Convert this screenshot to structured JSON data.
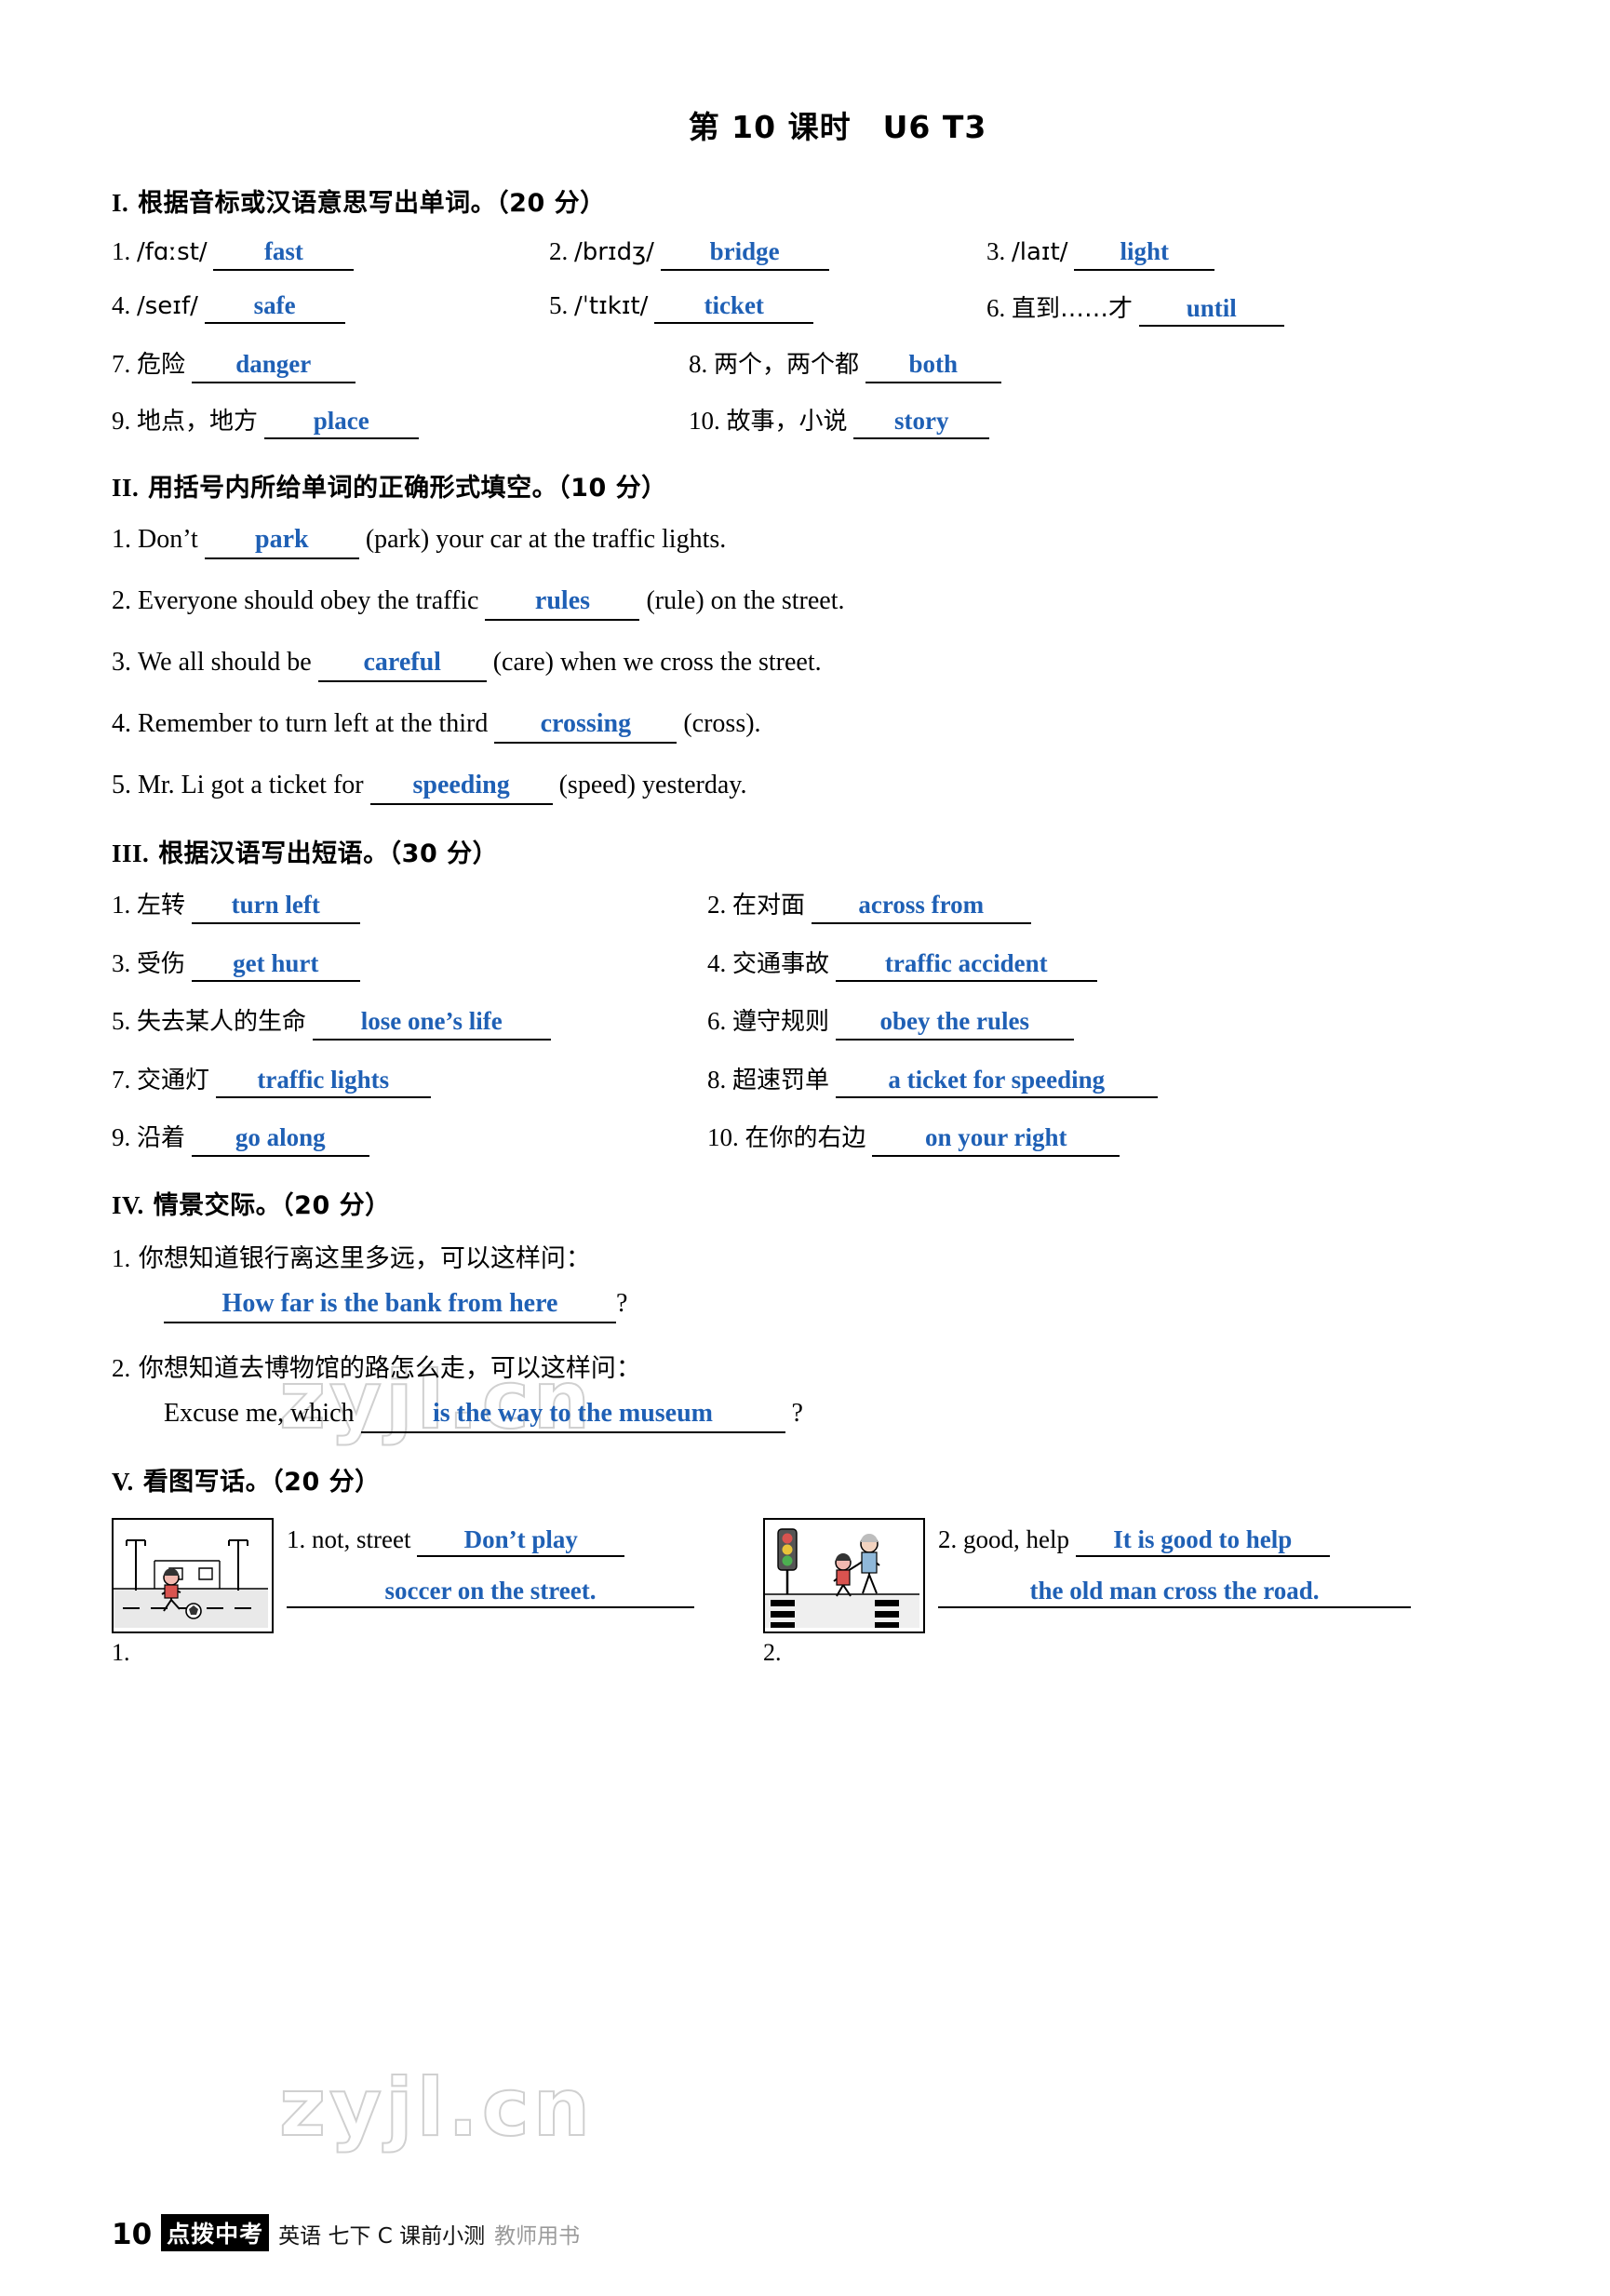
{
  "title": {
    "lesson": "第 10 课时",
    "unit": "U6  T3"
  },
  "sections": [
    {
      "id": "I",
      "heading": "根据音标或汉语意思写出单词。（20 分）",
      "items": [
        {
          "num": "1.",
          "prompt": "/fɑːst/",
          "answer": "fast"
        },
        {
          "num": "2.",
          "prompt": "/brɪdʒ/",
          "answer": "bridge"
        },
        {
          "num": "3.",
          "prompt": "/laɪt/",
          "answer": "light"
        },
        {
          "num": "4.",
          "prompt": "/seɪf/",
          "answer": "safe"
        },
        {
          "num": "5.",
          "prompt": "/ˈtɪkɪt/",
          "answer": "ticket"
        },
        {
          "num": "6.",
          "prompt": "直到……才",
          "answer": "until"
        },
        {
          "num": "7.",
          "prompt": "危险",
          "answer": "danger"
        },
        {
          "num": "8.",
          "prompt": "两个，两个都",
          "answer": "both"
        },
        {
          "num": "9.",
          "prompt": "地点，地方",
          "answer": "place"
        },
        {
          "num": "10.",
          "prompt": "故事，小说",
          "answer": "story"
        }
      ]
    },
    {
      "id": "II",
      "heading": "用括号内所给单词的正确形式填空。（10 分）",
      "items": [
        {
          "num": "1.",
          "before": "Don’t",
          "answer": "park",
          "after": "(park) your car at the traffic lights."
        },
        {
          "num": "2.",
          "before": "Everyone should obey the traffic",
          "answer": "rules",
          "after": "(rule) on the street."
        },
        {
          "num": "3.",
          "before": "We all should be",
          "answer": "careful",
          "after": "(care) when we cross the street."
        },
        {
          "num": "4.",
          "before": "Remember to turn left at the third",
          "answer": "crossing",
          "after": "(cross)."
        },
        {
          "num": "5.",
          "before": "Mr. Li got a ticket for",
          "answer": "speeding",
          "after": "(speed) yesterday."
        }
      ]
    },
    {
      "id": "III",
      "heading": "根据汉语写出短语。（30 分）",
      "items": [
        {
          "num": "1.",
          "prompt": "左转",
          "answer": "turn left"
        },
        {
          "num": "2.",
          "prompt": "在对面",
          "answer": "across from"
        },
        {
          "num": "3.",
          "prompt": "受伤",
          "answer": "get hurt"
        },
        {
          "num": "4.",
          "prompt": "交通事故",
          "answer": "traffic accident"
        },
        {
          "num": "5.",
          "prompt": "失去某人的生命",
          "answer": "lose one’s life"
        },
        {
          "num": "6.",
          "prompt": "遵守规则",
          "answer": "obey the rules"
        },
        {
          "num": "7.",
          "prompt": "交通灯",
          "answer": "traffic lights"
        },
        {
          "num": "8.",
          "prompt": "超速罚单",
          "answer": "a ticket for speeding"
        },
        {
          "num": "9.",
          "prompt": "沿着",
          "answer": "go along"
        },
        {
          "num": "10.",
          "prompt": "在你的右边",
          "answer": "on your right"
        }
      ]
    },
    {
      "id": "IV",
      "heading": "情景交际。（20 分）",
      "items": [
        {
          "num": "1.",
          "question": "你想知道银行离这里多远，可以这样问：",
          "before": "",
          "answer": "How far is the bank from here",
          "after": "?"
        },
        {
          "num": "2.",
          "question": "你想知道去博物馆的路怎么走，可以这样问：",
          "before": "Excuse me, which",
          "answer": "is the way to the museum",
          "after": "?"
        }
      ]
    },
    {
      "id": "V",
      "heading": "看图写话。（20 分）",
      "pictures": [
        {
          "caption": "1.",
          "prompt": "1. not, street",
          "answer_line1": "Don’t play",
          "answer_line2": "soccer on the street.",
          "icon": "children-playing-soccer-street-picture"
        },
        {
          "caption": "2.",
          "prompt": "2. good, help",
          "answer_line1": "It is good to help",
          "answer_line2": "the old man cross the road.",
          "icon": "helping-old-man-cross-road-picture"
        }
      ]
    }
  ],
  "watermarks": [
    "zyjl.cn",
    "zyjl.cn"
  ],
  "footer": {
    "page": "10",
    "brand": "点拨中考",
    "text": "英语 七下 C 课前小测",
    "text2": "教师用书"
  }
}
